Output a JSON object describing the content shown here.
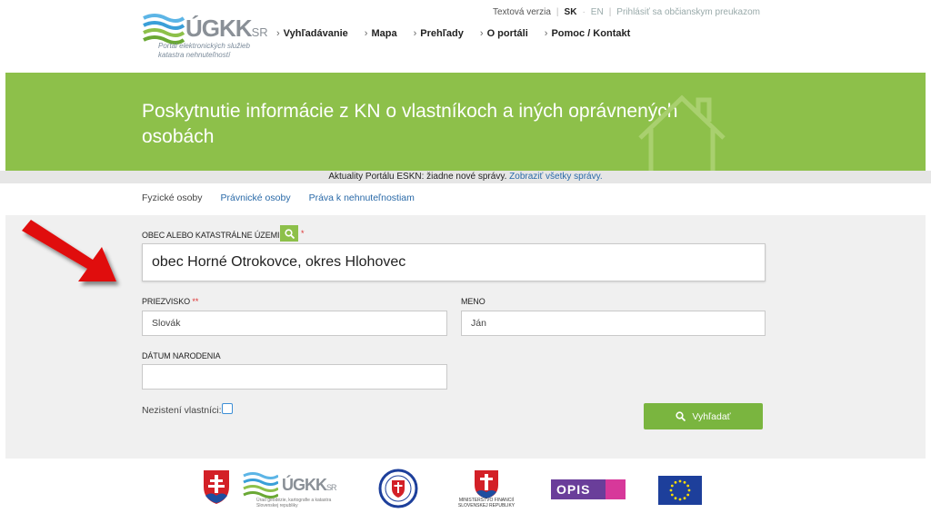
{
  "header": {
    "logo": {
      "name": "ÚGKK",
      "suffix": "SR",
      "subtitle": "Portál elektronických služieb katastra nehnuteľností"
    },
    "top_links": {
      "text_version": "Textová verzia",
      "lang_sk": "SK",
      "lang_en": "EN",
      "login": "Prihlásiť sa občianskym preukazom"
    },
    "nav": [
      "Vyhľadávanie",
      "Mapa",
      "Prehľady",
      "O portáli",
      "Pomoc / Kontakt"
    ]
  },
  "banner": {
    "title": "Poskytnutie informácie z KN o vlastníkoch a iných oprávnených osobách",
    "color": "#8dc04a"
  },
  "news": {
    "text": "Aktuality Portálu ESKN: žiadne nové správy.",
    "link": "Zobraziť všetky správy."
  },
  "tabs": [
    {
      "label": "Fyzické osoby",
      "active": true
    },
    {
      "label": "Právnické osoby",
      "active": false
    },
    {
      "label": "Práva k nehnuteľnostiam",
      "active": false
    }
  ],
  "form": {
    "municipality": {
      "label": "OBEC ALEBO KATASTRÁLNE ÚZEMIE",
      "required": "*",
      "value": "obec Horné Otrokovce, okres Hlohovec"
    },
    "surname": {
      "label": "PRIEZVISKO",
      "required": "**",
      "value": "Slovák"
    },
    "firstname": {
      "label": "MENO",
      "value": "Ján"
    },
    "birthdate": {
      "label": "DÁTUM NARODENIA",
      "value": ""
    },
    "unknown_owners": {
      "label": "Nezistení vlastníci:",
      "checked": false
    },
    "search_button": "Vyhľadať"
  },
  "footer": {
    "ugkk_logo": {
      "name": "ÚGKK",
      "suffix": "SR",
      "subtitle": "Úrad geodézie, kartografie a katastra Slovenskej republiky"
    },
    "mf_text": "MINISTERSTVO FINANCIÍ SLOVENSKEJ REPUBLIKY",
    "opis_text": "OPIS"
  },
  "colors": {
    "accent_green": "#8dc04a",
    "link_blue": "#2a6aa8",
    "arrow_red": "#e01010"
  }
}
